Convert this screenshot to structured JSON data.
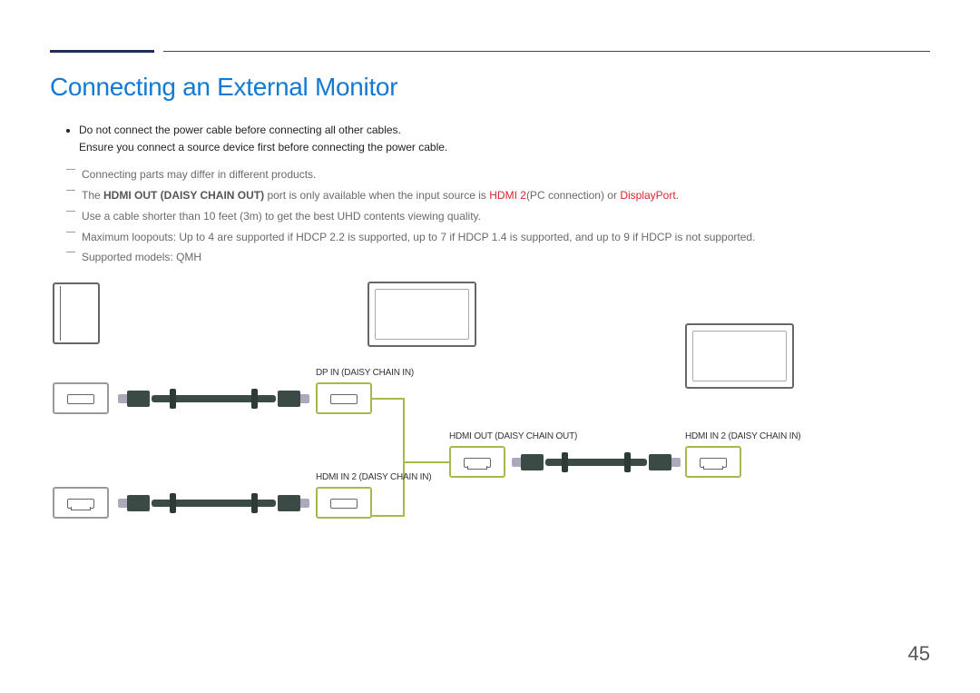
{
  "header": {
    "title": "Connecting an External Monitor"
  },
  "bullets": {
    "b1": "Do not connect the power cable before connecting all other cables.",
    "b1b": "Ensure you connect a source device first before connecting the power cable."
  },
  "notes": {
    "n1": "Connecting parts may differ in different products.",
    "n2_pre": "The ",
    "n2_bold": "HDMI OUT (DAISY CHAIN OUT)",
    "n2_mid": " port is only available when the input source is ",
    "n2_red1": "HDMI 2",
    "n2_mid2": "(PC connection) or ",
    "n2_red2": "DisplayPort",
    "n2_end": ".",
    "n3": "Use a cable shorter than 10 feet (3m) to get the best UHD contents viewing quality.",
    "n4": "Maximum loopouts: Up to 4 are supported if HDCP 2.2 is supported, up to 7 if HDCP 1.4 is supported, and up to 9 if HDCP is not supported.",
    "n5": "Supported models: QMH"
  },
  "labels": {
    "dp_in": "DP IN (DAISY CHAIN IN)",
    "hdmi_in2_a": "HDMI IN 2 (DAISY CHAIN IN)",
    "hdmi_out": "HDMI OUT (DAISY CHAIN OUT)",
    "hdmi_in2_b": "HDMI IN 2 (DAISY CHAIN IN)"
  },
  "page": {
    "num": "45"
  }
}
